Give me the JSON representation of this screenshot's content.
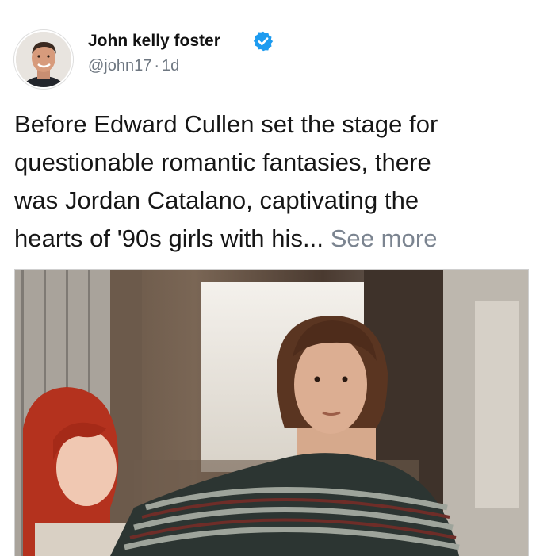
{
  "author": {
    "name": "John kelly foster",
    "handle": "@john17",
    "separator": "·",
    "time": "1d",
    "verified_icon": "verified-badge-icon",
    "avatar_icon": "profile-avatar"
  },
  "tweet": {
    "lines": [
      "Before Edward Cullen set the stage for",
      "questionable romantic fantasies, there",
      "was Jordan Catalano, captivating the",
      "hearts of '90s girls with his..."
    ],
    "see_more": "See more"
  },
  "media": {
    "kind": "photo"
  },
  "colors": {
    "verified": "#1d9bf0",
    "secondary_text": "#6e7781",
    "see_more": "#7b8490"
  }
}
